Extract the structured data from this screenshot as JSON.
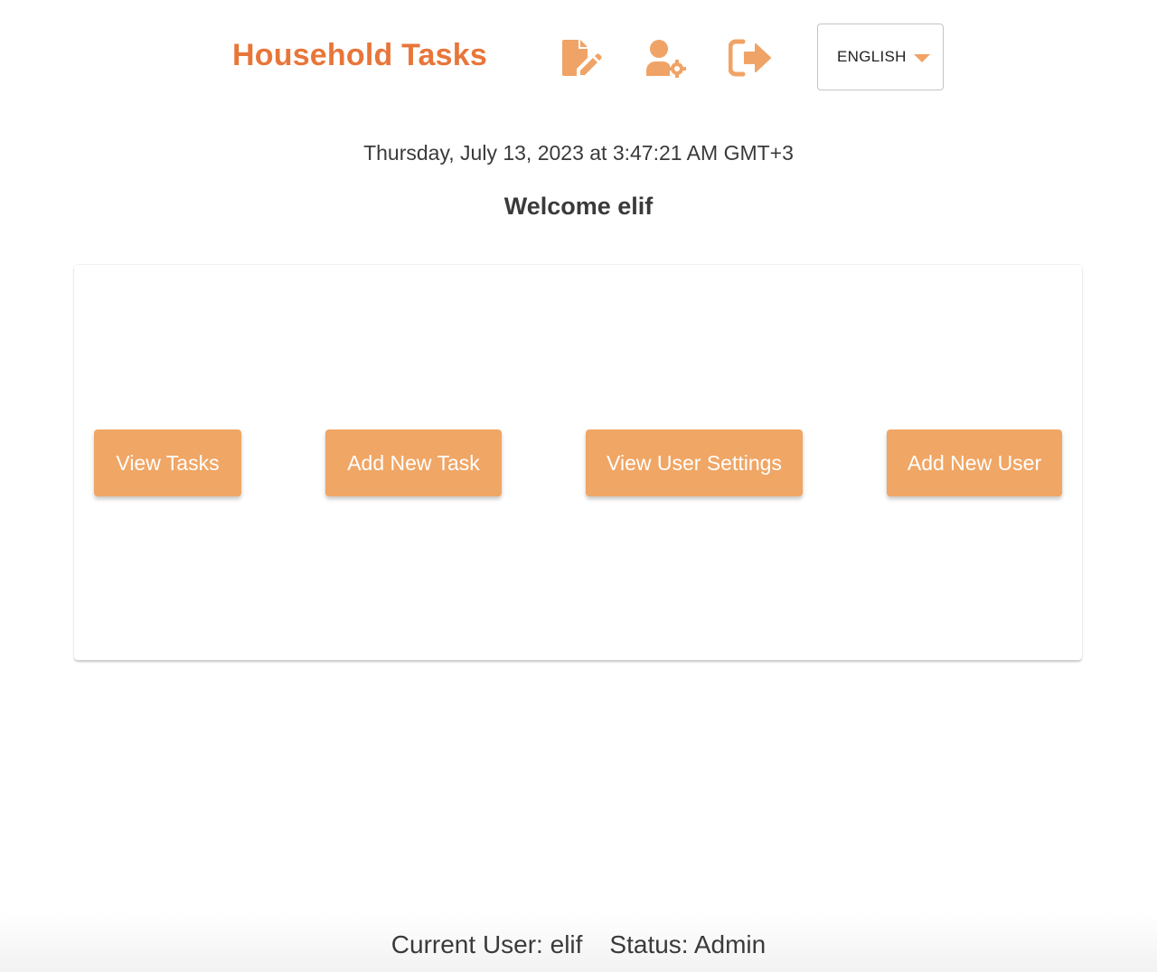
{
  "header": {
    "title": "Household Tasks",
    "icons": {
      "edit_task": "edit-document-icon",
      "user_settings": "user-settings-icon",
      "logout": "logout-icon"
    },
    "language": {
      "selected": "ENGLISH"
    }
  },
  "datetime": "Thursday, July 13, 2023 at 3:47:21 AM GMT+3",
  "welcome": "Welcome elif",
  "actions": {
    "view_tasks": "View Tasks",
    "add_task": "Add New Task",
    "view_user_settings": "View User Settings",
    "add_user": "Add New User"
  },
  "footer": {
    "current_user": "Current User: elif",
    "status": "Status: Admin"
  },
  "colors": {
    "brand": "#e8763a",
    "button": "#f0a665",
    "icon": "#f0a366",
    "text": "#3a3a3a"
  }
}
